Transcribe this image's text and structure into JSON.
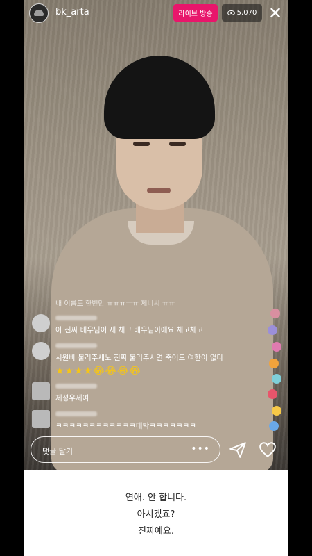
{
  "header": {
    "username": "bk_arta",
    "live_badge": "라이브 방송",
    "viewer_count": "5,070"
  },
  "stream": {
    "join_notice": "내 이름도 한번만 ㅠㅠㅠㅠㅠ 제니씨 ㅠㅠ"
  },
  "comments": [
    {
      "text": "아 진짜 배우님이 세 채고 배우님이에요 체고체고"
    },
    {
      "text": "시원바 불러주세노 진짜 불러주시면 죽어도 여한이 없다",
      "emoji": "★★★★😂😂😂😂"
    },
    {
      "text": "제성우세여"
    },
    {
      "text": "ㅋㅋㅋㅋㅋㅋㅋㅋㅋㅋㅋㅋ대박ㅋㅋㅋㅋㅋㅋㅋ"
    }
  ],
  "composer": {
    "placeholder": "댓글 달기",
    "more": "•••"
  },
  "caption": {
    "line1": "연애. 안 합니다.",
    "line2": "아시겠죠?",
    "line3": "진짜예요."
  },
  "colors": {
    "live_badge": "#e8166b",
    "caption_bg": "#ffffff"
  },
  "icons": [
    "eye-icon",
    "close-icon",
    "more-icon",
    "send-icon",
    "heart-icon"
  ]
}
